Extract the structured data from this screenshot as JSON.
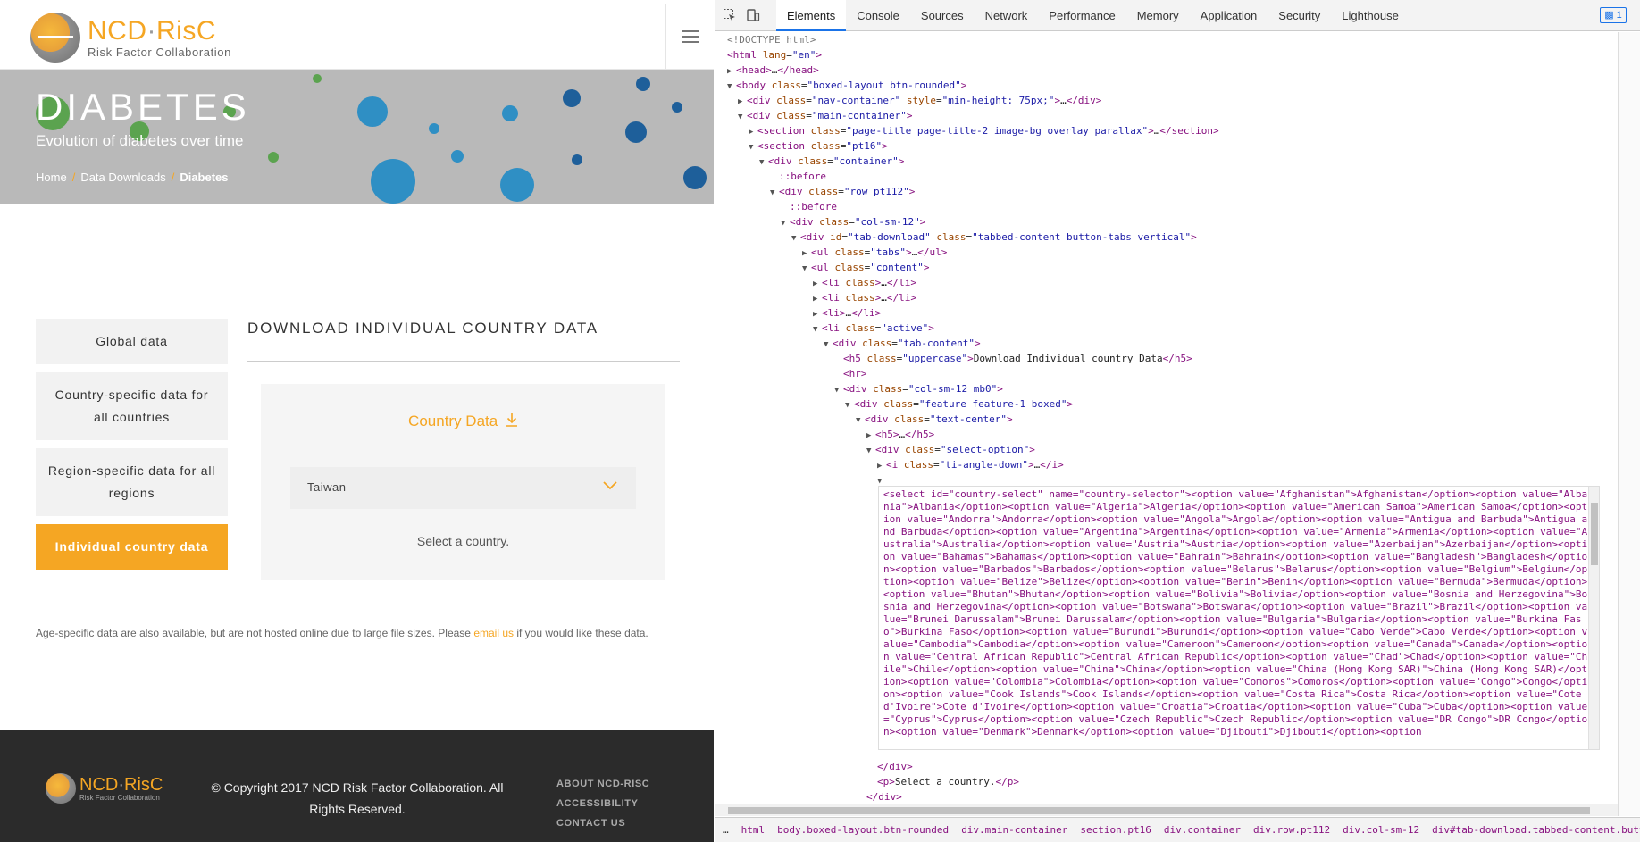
{
  "site": {
    "logo_title_a": "NCD",
    "logo_title_dot": "·",
    "logo_title_b": "RisC",
    "logo_sub": "Risk Factor Collaboration",
    "hero_title": "DIABETES",
    "hero_sub": "Evolution of diabetes over time",
    "crumbs": [
      "Home",
      "Data Downloads",
      "Diabetes"
    ],
    "crumb_sep": "/",
    "tabs": [
      "Global data",
      "Country-specific data for all countries",
      "Region-specific data for all regions",
      "Individual country data"
    ],
    "download_title": "DOWNLOAD INDIVIDUAL COUNTRY DATA",
    "box_head": "Country Data",
    "select_value": "Taiwan",
    "box_help": "Select a country.",
    "note_a": "Age-specific data are also available, but are not hosted online due to large file sizes. Please ",
    "note_link": "email us",
    "note_b": " if you would like these data.",
    "footer_copy": "© Copyright 2017 NCD Risk Factor Collaboration. All Rights Reserved.",
    "footer_links": [
      "ABOUT NCD-RISC",
      "ACCESSIBILITY",
      "CONTACT US"
    ]
  },
  "devtools": {
    "tabs": [
      "Elements",
      "Console",
      "Sources",
      "Network",
      "Performance",
      "Memory",
      "Application",
      "Security",
      "Lighthouse"
    ],
    "active_tab": "Elements",
    "badge": "1",
    "select_html": "<select id=\"country-select\" name=\"country-selector\"><option value=\"Afghanistan\">Afghanistan</option><option value=\"Albania\">Albania</option><option value=\"Algeria\">Algeria</option><option value=\"American Samoa\">American Samoa</option><option value=\"Andorra\">Andorra</option><option value=\"Angola\">Angola</option><option value=\"Antigua and Barbuda\">Antigua and Barbuda</option><option value=\"Argentina\">Argentina</option><option value=\"Armenia\">Armenia</option><option value=\"Australia\">Australia</option><option value=\"Austria\">Austria</option><option value=\"Azerbaijan\">Azerbaijan</option><option value=\"Bahamas\">Bahamas</option><option value=\"Bahrain\">Bahrain</option><option value=\"Bangladesh\">Bangladesh</option><option value=\"Barbados\">Barbados</option><option value=\"Belarus\">Belarus</option><option value=\"Belgium\">Belgium</option><option value=\"Belize\">Belize</option><option value=\"Benin\">Benin</option><option value=\"Bermuda\">Bermuda</option><option value=\"Bhutan\">Bhutan</option><option value=\"Bolivia\">Bolivia</option><option value=\"Bosnia and Herzegovina\">Bosnia and Herzegovina</option><option value=\"Botswana\">Botswana</option><option value=\"Brazil\">Brazil</option><option value=\"Brunei Darussalam\">Brunei Darussalam</option><option value=\"Bulgaria\">Bulgaria</option><option value=\"Burkina Faso\">Burkina Faso</option><option value=\"Burundi\">Burundi</option><option value=\"Cabo Verde\">Cabo Verde</option><option value=\"Cambodia\">Cambodia</option><option value=\"Cameroon\">Cameroon</option><option value=\"Canada\">Canada</option><option value=\"Central African Republic\">Central African Republic</option><option value=\"Chad\">Chad</option><option value=\"Chile\">Chile</option><option value=\"China\">China</option><option value=\"China (Hong Kong SAR)\">China (Hong Kong SAR)</option><option value=\"Colombia\">Colombia</option><option value=\"Comoros\">Comoros</option><option value=\"Congo\">Congo</option><option value=\"Cook Islands\">Cook Islands</option><option value=\"Costa Rica\">Costa Rica</option><option value=\"Cote d'Ivoire\">Cote d'Ivoire</option><option value=\"Croatia\">Croatia</option><option value=\"Cuba\">Cuba</option><option value=\"Cyprus\">Cyprus</option><option value=\"Czech Republic\">Czech Republic</option><option value=\"DR Congo\">DR Congo</option><option value=\"Denmark\">Denmark</option><option value=\"Djibouti\">Djibouti</option><option",
    "breadcrumbs": [
      "…",
      "html",
      "body.boxed-layout.btn-rounded",
      "div.main-container",
      "section.pt16",
      "div.container",
      "div.row.pt112",
      "div.col-sm-12",
      "div#tab-download.tabbed-content.button-tabs.vertical",
      "…"
    ]
  },
  "colors": {
    "accent": "#f5a623",
    "devtools_blue": "#1a73e8"
  }
}
